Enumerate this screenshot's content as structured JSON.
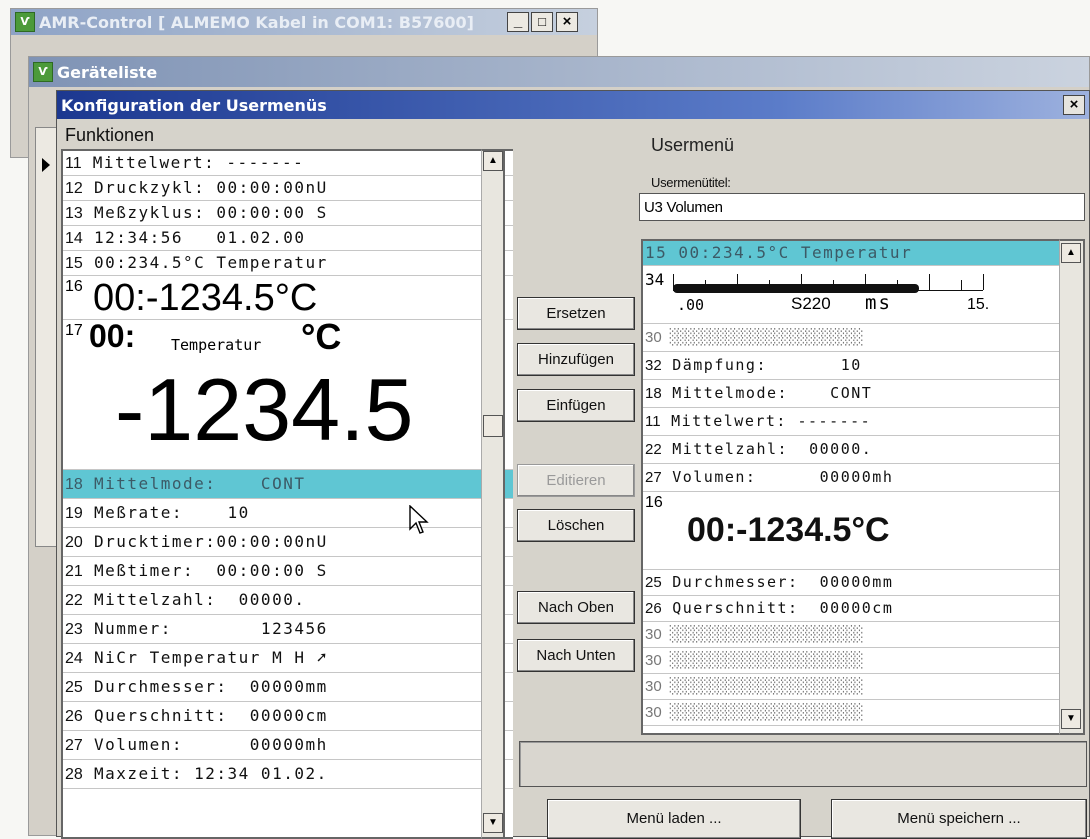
{
  "back_window": {
    "title": "AMR-Control [ ALMEMO Kabel in COM1: B57600]",
    "minimize": "_",
    "maximize": "□",
    "close": "×"
  },
  "device_window": {
    "title": "Geräteliste"
  },
  "dialog": {
    "title": "Konfiguration der Usermenüs",
    "close": "×"
  },
  "functions": {
    "label": "Funktionen",
    "rows": [
      {
        "num": "11",
        "text": "Mittelwert: -------"
      },
      {
        "num": "12",
        "text": "Druckzykl: 00:00:00nU"
      },
      {
        "num": "13",
        "text": "Meßzyklus: 00:00:00 S"
      },
      {
        "num": "14",
        "text": "12:34:56   01.02.00"
      },
      {
        "num": "15",
        "text": "00:234.5°C Temperatur"
      }
    ],
    "big16": {
      "num": "16",
      "text": "00:-1234.5°C"
    },
    "big17": {
      "num": "17",
      "prefix": "00:",
      "label": "Temperatur",
      "unit": "°C",
      "value": "-1234.5"
    },
    "rows_lower": [
      {
        "num": "18",
        "text": "Mittelmode:    CONT"
      },
      {
        "num": "19",
        "text": "Meßrate:    10"
      },
      {
        "num": "20",
        "text": "Drucktimer:00:00:00nU"
      },
      {
        "num": "21",
        "text": "Meßtimer:  00:00:00 S"
      },
      {
        "num": "22",
        "text": "Mittelzahl:  00000."
      },
      {
        "num": "23",
        "text": "Nummer:        123456"
      },
      {
        "num": "24",
        "text": "NiCr Temperatur M H ➚"
      },
      {
        "num": "25",
        "text": "Durchmesser:  00000mm"
      },
      {
        "num": "26",
        "text": "Querschnitt:  00000cm"
      },
      {
        "num": "27",
        "text": "Volumen:      00000mh"
      },
      {
        "num": "28",
        "text": "Maxzeit: 12:34 01.02."
      }
    ],
    "selected_index": 0
  },
  "buttons": {
    "ersetzen": "Ersetzen",
    "hinzufuegen": "Hinzufügen",
    "einfuegen": "Einfügen",
    "editieren": "Editieren",
    "loeschen": "Löschen",
    "nach_oben": "Nach Oben",
    "nach_unten": "Nach Unten",
    "menu_laden": "Menü laden ...",
    "menu_speichern": "Menü speichern ..."
  },
  "usermenu": {
    "heading": "Usermenü",
    "title_label": "Usermenütitel:",
    "title_value": "U3 Volumen",
    "row15": {
      "num": "15",
      "text": "00:234.5°C Temperatur"
    },
    "bar34": {
      "num": "34",
      "left": ".00",
      "mid": "S220",
      "unit": "ms",
      "right": "15."
    },
    "rows_a": [
      {
        "num": "30",
        "text": "░░░░░░░░░░░░░░░░░░░░░░░░"
      },
      {
        "num": "32",
        "text": "Dämpfung:       10"
      },
      {
        "num": "18",
        "text": "Mittelmode:    CONT"
      },
      {
        "num": "11",
        "text": "Mittelwert: -------"
      },
      {
        "num": "22",
        "text": "Mittelzahl:  00000."
      },
      {
        "num": "27",
        "text": "Volumen:      00000mh"
      }
    ],
    "big16": {
      "num": "16",
      "text": "00:-1234.5°C"
    },
    "rows_b": [
      {
        "num": "25",
        "text": "Durchmesser:  00000mm"
      },
      {
        "num": "26",
        "text": "Querschnitt:  00000cm"
      },
      {
        "num": "30",
        "text": "░░░░░░░░░░░░░░░░░░░░░░░░"
      },
      {
        "num": "30",
        "text": "░░░░░░░░░░░░░░░░░░░░░░░░"
      },
      {
        "num": "30",
        "text": "░░░░░░░░░░░░░░░░░░░░░░░░"
      },
      {
        "num": "30",
        "text": "░░░░░░░░░░░░░░░░░░░░░░░░"
      }
    ]
  },
  "status_text": "",
  "colors": {
    "accent": "#5fc6d3",
    "titlebar_active": "#1f3a8f",
    "titlebar_inactive": "#a9b6c9"
  }
}
